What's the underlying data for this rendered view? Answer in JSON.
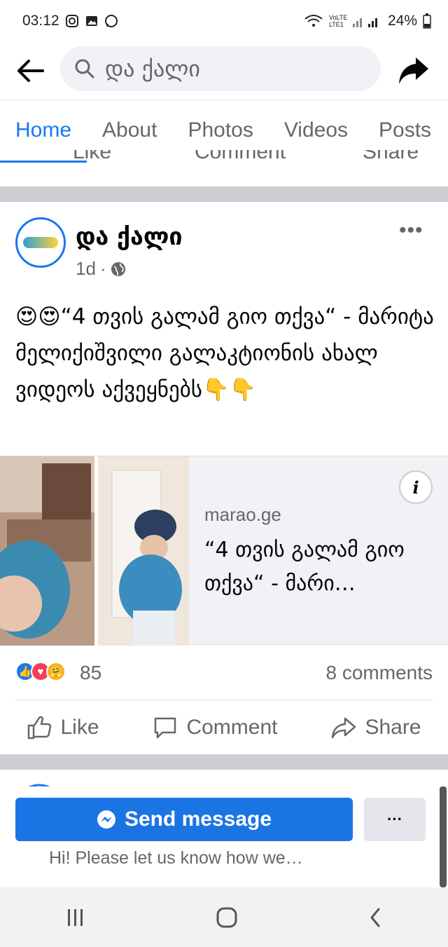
{
  "status": {
    "time": "03:12",
    "battery": "24%",
    "network": "VoLTE LTE1"
  },
  "search": {
    "query": "და ქალი"
  },
  "tabs": [
    "Home",
    "About",
    "Photos",
    "Videos",
    "Posts"
  ],
  "prev_actions": {
    "like": "Like",
    "comment": "Comment",
    "share": "Share"
  },
  "post": {
    "page_name": "და ქალი",
    "time": "1d",
    "text": "😍😍“4 თვის გალამ გიო თქვა“ - მარიტა მელიქიშვილი გალაკტიონის ახალ ვიდეოს აქვეყნებს👇👇",
    "link": {
      "domain": "marao.ge",
      "title": "“4 თვის გალამ გიო თქვა“ - მარი…"
    },
    "reactions_count": "85",
    "comments_count": "8 comments",
    "actions": {
      "like": "Like",
      "comment": "Comment",
      "share": "Share"
    }
  },
  "message_bar": {
    "send_label": "Send message",
    "more_label": "···",
    "hint": "Hi! Please let us know how we…"
  },
  "colors": {
    "brand": "#1877f2",
    "send_button": "#1b74e4"
  }
}
